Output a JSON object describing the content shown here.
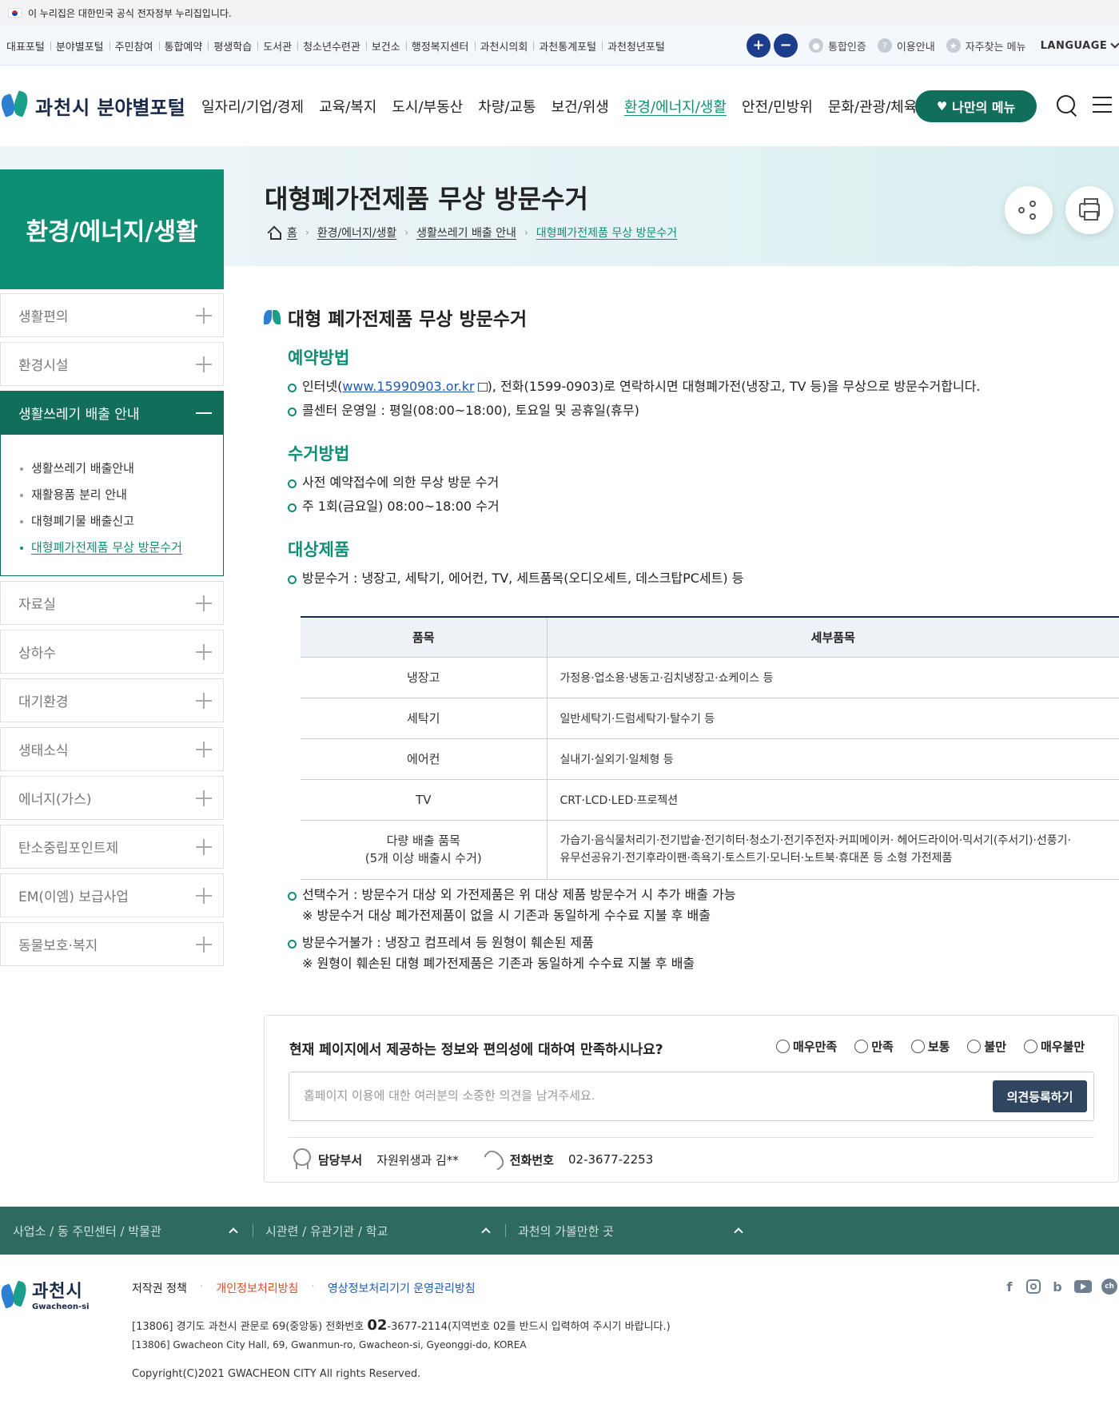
{
  "gov_banner": "이 누리집은 대한민국 공식 전자정부 누리집입니다.",
  "portals": [
    "대표포털",
    "분야별포털",
    "주민참여",
    "통합예약",
    "평생학습",
    "도서관",
    "청소년수련관",
    "보건소",
    "행정복지센터",
    "과천시의회",
    "과천통계포털",
    "과천청년포털"
  ],
  "zoom": {
    "in": "+",
    "out": "−"
  },
  "utils": {
    "auth": "통합인증",
    "guide": "이용안내",
    "faq": "자주찾는 메뉴",
    "language": "LANGUAGE"
  },
  "logo": {
    "city": "과천시",
    "portal": "분야별포털"
  },
  "gnb": [
    "일자리/기업/경제",
    "교육/복지",
    "도시/부동산",
    "차량/교통",
    "보건/위생",
    "환경/에너지/생활",
    "안전/민방위",
    "문화/관광/체육"
  ],
  "my_menu": "나만의 메뉴",
  "section_title": "환경/에너지/생활",
  "page_title": "대형폐가전제품 무상 방문수거",
  "breadcrumb": [
    "홈",
    "환경/에너지/생활",
    "생활쓰레기 배출 안내",
    "대형폐가전제품 무상 방문수거"
  ],
  "lnb": {
    "before": [
      "생활편의",
      "환경시설"
    ],
    "open": "생활쓰레기 배출 안내",
    "sub": [
      "생활쓰레기 배출안내",
      "재활용품 분리 안내",
      "대형폐기물 배출신고",
      "대형폐가전제품 무상 방문수거"
    ],
    "after": [
      "자료실",
      "상하수",
      "대기환경",
      "생태소식",
      "에너지(가스)",
      "탄소중립포인트제",
      "EM(이엠) 보급사업",
      "동물보호·복지"
    ]
  },
  "content": {
    "heading": "대형 폐가전제품 무상 방문수거",
    "reserve": {
      "title": "예약방법",
      "b1_pre": "인터넷(",
      "b1_link": "www.15990903.or.kr",
      "b1_post": "), 전화(1599-0903)로 연락하시면 대형폐가전(냉장고, TV 등)을 무상으로 방문수거합니다.",
      "b2": "콜센터 운영일 : 평일(08:00~18:00), 토요일 및 공휴일(휴무)"
    },
    "collect": {
      "title": "수거방법",
      "b1": "사전 예약접수에 의한 무상 방문 수거",
      "b2": "주 1회(금요일) 08:00~18:00 수거"
    },
    "target": {
      "title": "대상제품",
      "b1": "방문수거 : 냉장고, 세탁기, 에어컨, TV, 세트품목(오디오세트, 데스크탑PC세트) 등"
    },
    "table": {
      "headers": [
        "품목",
        "세부품목"
      ],
      "rows": [
        {
          "cat": "냉장고",
          "det": "가정용·업소용·냉동고·김치냉장고·쇼케이스 등"
        },
        {
          "cat": "세탁기",
          "det": "일반세탁기·드럼세탁기·탈수기 등"
        },
        {
          "cat": "에어컨",
          "det": "실내기·실외기·일체형 등"
        },
        {
          "cat": "TV",
          "det": "CRT·LCD·LED·프로젝션"
        }
      ],
      "last": {
        "cat1": "다량 배출 품목",
        "cat2": "(5개 이상 배출시 수거)",
        "det1": "가습기·음식물처리기·전기밥솥·전기히터·청소기·전기주전자·커피메이커· 헤어드라이어·믹서기(주서기)·선풍기·",
        "det2": "유무선공유기·전기후라이팬·족욕기·토스트기·모니터·노트북·휴대폰 등 소형 가전제품"
      }
    },
    "after": {
      "b3": "선택수거 : 방문수거 대상 외 가전제품은 위 대상 제품 방문수거 시 추가 배출 가능",
      "n3": "※ 방문수거 대상 폐가전제품이 없을 시 기존과 동일하게 수수료 지불 후 배출",
      "b4": "방문수거불가 : 냉장고 컴프레셔 등 원형이 훼손된 제품",
      "n4": "※ 원형이 훼손된 대형 폐가전제품은 기존과 동일하게 수수료 지불 후 배출"
    }
  },
  "survey": {
    "question": "현재 페이지에서 제공하는 정보와 편의성에 대하여 만족하시나요?",
    "options": [
      "매우만족",
      "만족",
      "보통",
      "불만",
      "매우불만"
    ],
    "placeholder": "홈페이지 이용에 대한 여러분의 소중한 의견을 남겨주세요.",
    "submit": "의견등록하기",
    "dept_label": "담당부서",
    "dept_value": "자원위생과 김**",
    "tel_label": "전화번호",
    "tel_value": "02-3677-2253"
  },
  "footer": {
    "bar": [
      "사업소 / 동 주민센터 / 박물관",
      "시관련 / 유관기관 / 학교",
      "과천의 가볼만한 곳"
    ],
    "logo_ko": "과천시",
    "logo_en": "Gwacheon-si",
    "links": [
      "저작권 정책",
      "개인정보처리방침",
      "영상정보처리기기 운영관리방침"
    ],
    "addr_pre": "[13806] 경기도 과천시 관문로 69(중앙동)    전화번호",
    "addr_tel": "02",
    "addr_post": "-3677-2114(지역번호 02를 반드시 입력하여 주시기 바랍니다.)",
    "addr_en": "[13806] Gwacheon City Hall, 69, Gwanmun-ro, Gwacheon-si, Gyeonggi-do, KOREA",
    "copyright": "Copyright(C)2021 GWACHEON CITY All rights Reserved.",
    "sns": {
      "facebook": "f",
      "blog": "b",
      "channel": "ch"
    }
  }
}
